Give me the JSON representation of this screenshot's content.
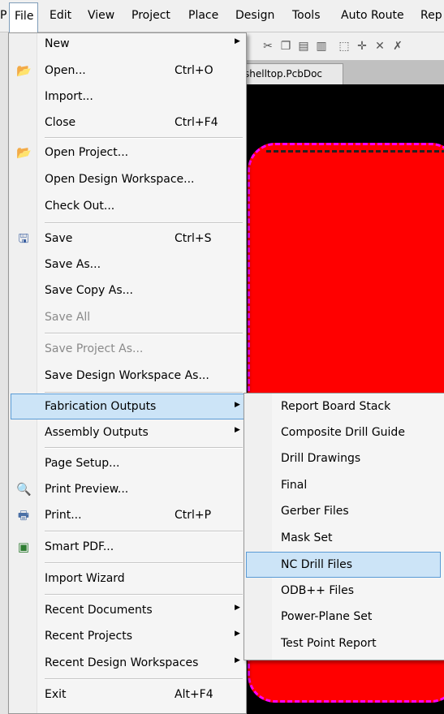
{
  "menubar": {
    "items": [
      {
        "id": "file",
        "label": "File"
      },
      {
        "id": "edit",
        "label": "Edit"
      },
      {
        "id": "view",
        "label": "View"
      },
      {
        "id": "project",
        "label": "Project"
      },
      {
        "id": "place",
        "label": "Place"
      },
      {
        "id": "design",
        "label": "Design"
      },
      {
        "id": "tools",
        "label": "Tools"
      },
      {
        "id": "autoroute",
        "label": "Auto Route"
      },
      {
        "id": "rep",
        "label": "Rep"
      }
    ]
  },
  "tab": {
    "title": "shelltop.PcbDoc"
  },
  "file_menu": {
    "new": {
      "label": "New"
    },
    "open": {
      "label": "Open...",
      "shortcut": "Ctrl+O"
    },
    "import": {
      "label": "Import..."
    },
    "close": {
      "label": "Close",
      "shortcut": "Ctrl+F4"
    },
    "open_project": {
      "label": "Open Project..."
    },
    "open_design_workspace": {
      "label": "Open Design Workspace..."
    },
    "check_out": {
      "label": "Check Out..."
    },
    "save": {
      "label": "Save",
      "shortcut": "Ctrl+S"
    },
    "save_as": {
      "label": "Save As..."
    },
    "save_copy_as": {
      "label": "Save Copy As..."
    },
    "save_all": {
      "label": "Save All"
    },
    "save_project_as": {
      "label": "Save Project As..."
    },
    "save_design_workspace_as": {
      "label": "Save Design Workspace As..."
    },
    "fabrication_outputs": {
      "label": "Fabrication Outputs"
    },
    "assembly_outputs": {
      "label": "Assembly Outputs"
    },
    "page_setup": {
      "label": "Page Setup..."
    },
    "print_preview": {
      "label": "Print Preview..."
    },
    "print": {
      "label": "Print...",
      "shortcut": "Ctrl+P"
    },
    "smart_pdf": {
      "label": "Smart PDF..."
    },
    "import_wizard": {
      "label": "Import Wizard"
    },
    "recent_documents": {
      "label": "Recent Documents"
    },
    "recent_projects": {
      "label": "Recent Projects"
    },
    "recent_design_workspaces": {
      "label": "Recent Design Workspaces"
    },
    "exit": {
      "label": "Exit",
      "shortcut": "Alt+F4"
    }
  },
  "fab_menu": {
    "items": [
      {
        "label": "Report Board Stack"
      },
      {
        "label": "Composite Drill Guide"
      },
      {
        "label": "Drill Drawings"
      },
      {
        "label": "Final"
      },
      {
        "label": "Gerber Files"
      },
      {
        "label": "Mask Set"
      },
      {
        "label": "NC Drill Files"
      },
      {
        "label": "ODB++ Files"
      },
      {
        "label": "Power-Plane Set"
      },
      {
        "label": "Test Point Report"
      }
    ]
  },
  "colors": {
    "board": "#ff0000",
    "board_outline": "#ff00ff",
    "highlight": "#cce4f7"
  }
}
